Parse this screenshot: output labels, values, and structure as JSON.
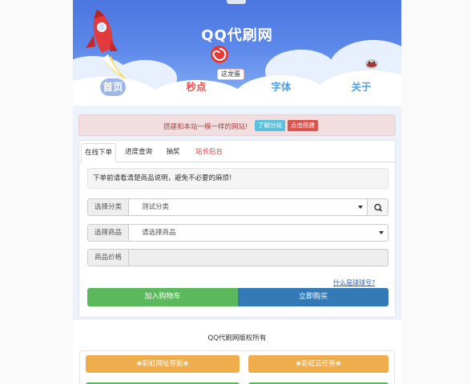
{
  "site": {
    "title": "QQ代刷网"
  },
  "tooltip": {
    "text": "这龙蛋"
  },
  "nav": {
    "items": [
      {
        "label": "首页",
        "active": true
      },
      {
        "label": "秒点"
      },
      {
        "label": "字体"
      },
      {
        "label": "关于"
      }
    ]
  },
  "alert": {
    "text": "搭建和本站一模一样的网站!",
    "learn_button": "了解分站",
    "build_button": "点击搭建"
  },
  "tabs": [
    {
      "label": "在线下单",
      "active": true
    },
    {
      "label": "进度查询"
    },
    {
      "label": "抽奖"
    },
    {
      "label": "站长后台"
    }
  ],
  "notice": {
    "text": "下单前请看清楚商品说明，避免不必要的麻烦!"
  },
  "form": {
    "category": {
      "label": "选择分类",
      "value": "测试分类"
    },
    "goods": {
      "label": "选择商品",
      "value": "请选择商品"
    },
    "price": {
      "label": "商品价格",
      "value": ""
    }
  },
  "help": {
    "text": "什么是球球号?"
  },
  "actions": {
    "cart": "加入购物车",
    "buy": "立即购买"
  },
  "footer": {
    "copyright": "QQ代刷网版权所有",
    "links": [
      {
        "label": "❀彩虹网址导航❀"
      },
      {
        "label": "❀彩虹云任务❀"
      }
    ]
  },
  "colors": {
    "banner": "#5c88ea",
    "alert_bg": "#f2dede",
    "success": "#5cb85c",
    "primary": "#337ab7",
    "warning": "#f0ad4e",
    "danger": "#d9534f",
    "info": "#5bc0de"
  },
  "icons": [
    "rocket-icon",
    "lollipop-icon",
    "mascot-icon",
    "search-icon",
    "caret-down-icon"
  ]
}
